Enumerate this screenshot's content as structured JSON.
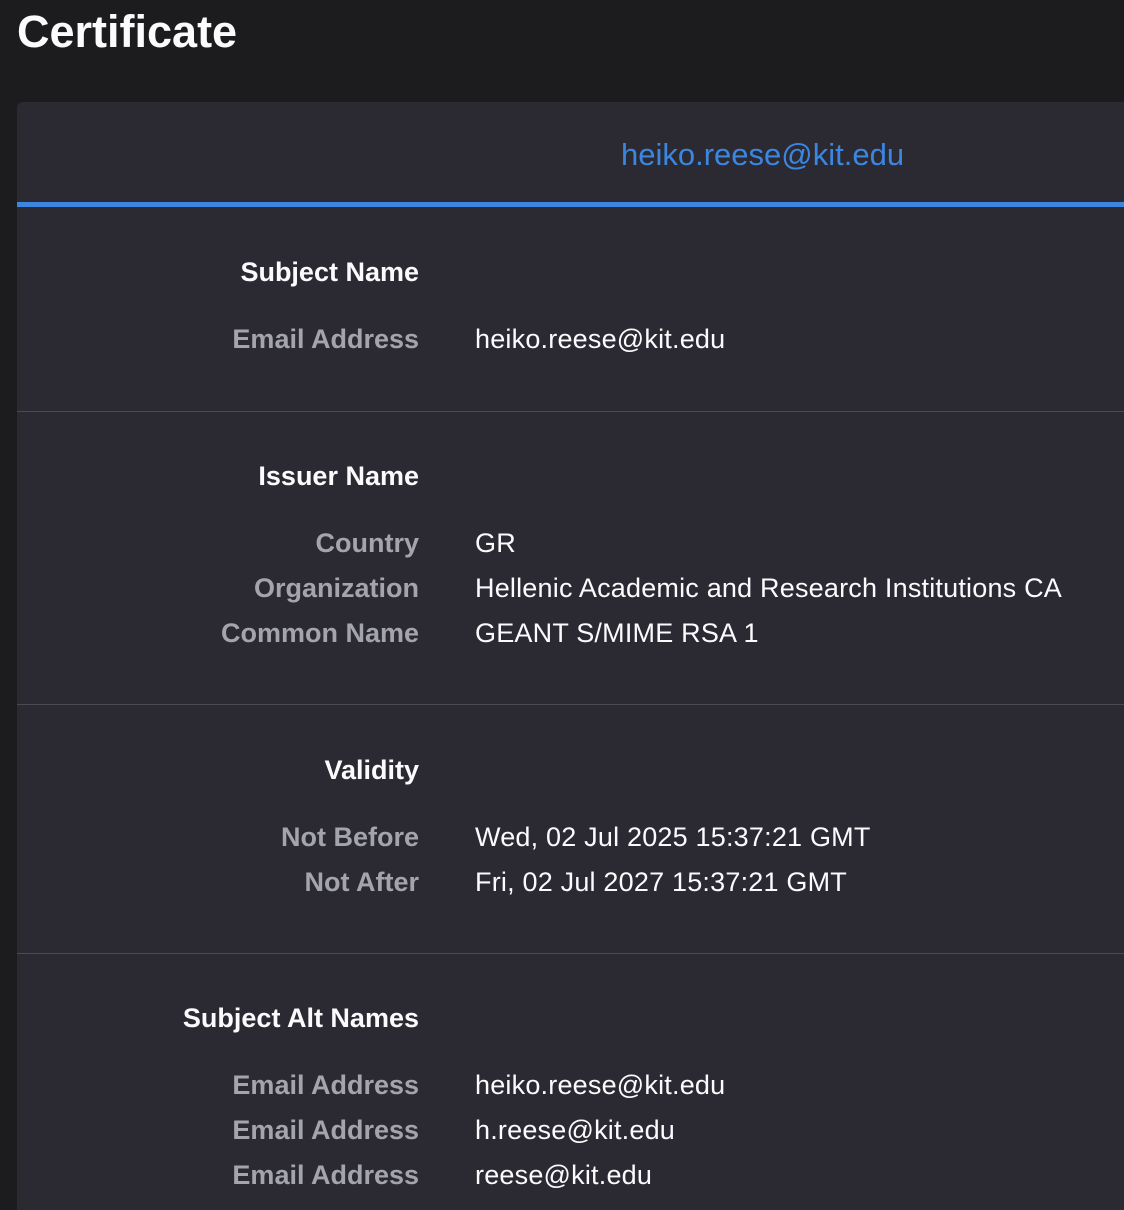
{
  "page": {
    "title": "Certificate"
  },
  "tabs": [
    {
      "label": "heiko.reese@kit.edu",
      "selected": true
    }
  ],
  "colors": {
    "accent": "#3a86e0",
    "background": "#1c1c1e",
    "card": "#2b2a33",
    "label": "#a4a4ab",
    "text": "#fbfbfe"
  },
  "sections": {
    "subject_name": {
      "heading": "Subject Name",
      "rows": [
        {
          "label": "Email Address",
          "value": "heiko.reese@kit.edu"
        }
      ]
    },
    "issuer_name": {
      "heading": "Issuer Name",
      "rows": [
        {
          "label": "Country",
          "value": "GR"
        },
        {
          "label": "Organization",
          "value": "Hellenic Academic and Research Institutions CA"
        },
        {
          "label": "Common Name",
          "value": "GEANT S/MIME RSA 1"
        }
      ]
    },
    "validity": {
      "heading": "Validity",
      "rows": [
        {
          "label": "Not Before",
          "value": "Wed, 02 Jul 2025 15:37:21 GMT"
        },
        {
          "label": "Not After",
          "value": "Fri, 02 Jul 2027 15:37:21 GMT"
        }
      ]
    },
    "subject_alt_names": {
      "heading": "Subject Alt Names",
      "rows": [
        {
          "label": "Email Address",
          "value": "heiko.reese@kit.edu"
        },
        {
          "label": "Email Address",
          "value": "h.reese@kit.edu"
        },
        {
          "label": "Email Address",
          "value": "reese@kit.edu"
        }
      ]
    }
  }
}
